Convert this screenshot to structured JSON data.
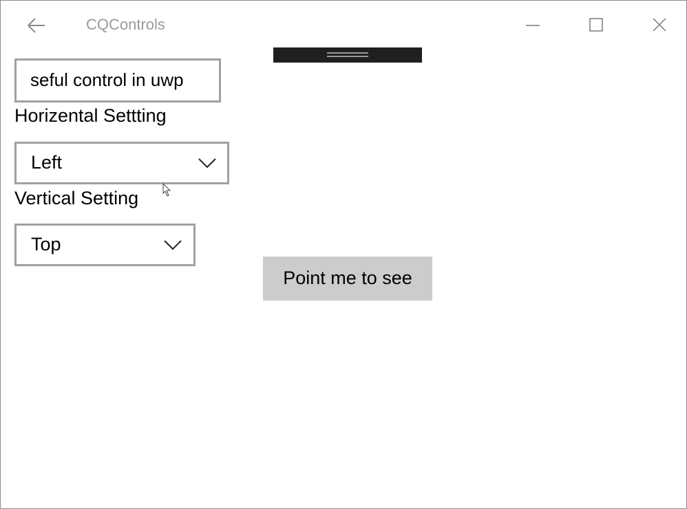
{
  "window": {
    "title": "CQControls"
  },
  "titlebar": {
    "back_icon": "arrow-left-icon",
    "min_icon": "minimize-icon",
    "max_icon": "maximize-icon",
    "close_icon": "close-icon"
  },
  "splitter": {
    "icon": "drag-grip-icon"
  },
  "textbox": {
    "value": "seful control in uwp"
  },
  "horizontal": {
    "label": "Horizental Settting",
    "selected": "Left"
  },
  "vertical": {
    "label": "Vertical Setting",
    "selected": "Top"
  },
  "main": {
    "button_label": "Point me to see"
  },
  "colors": {
    "border": "#a0a0a0",
    "button_bg": "#cccccc",
    "handle_bg": "#1f1f1f",
    "title_text": "#9a9a9a"
  }
}
